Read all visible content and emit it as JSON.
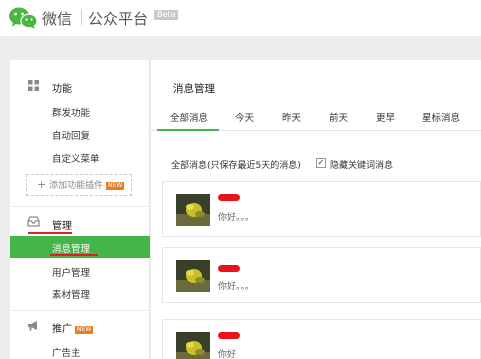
{
  "header": {
    "brand_wechat": "微信",
    "brand_platform": "公众平台",
    "beta": "Beta"
  },
  "sidebar": {
    "functions_title": "功能",
    "function_items": [
      "群发功能",
      "自动回复",
      "自定义菜单"
    ],
    "add_plugin": "添加功能插件",
    "new_badge": "NEW",
    "manage_title": "管理",
    "manage_items": [
      "消息管理",
      "用户管理",
      "素材管理"
    ],
    "promote_title": "推广",
    "promote_items": [
      "广告主"
    ]
  },
  "main": {
    "title": "消息管理",
    "tabs": [
      "全部消息",
      "今天",
      "昨天",
      "前天",
      "更早",
      "星标消息"
    ],
    "active_tab": "全部消息",
    "filter_text": "全部消息(只保存最近5天的消息)",
    "hide_keyword": {
      "label": "隐藏关键词消息",
      "checked": true
    },
    "messages": [
      {
        "text": "你好。。。"
      },
      {
        "text": "你好。。。"
      },
      {
        "text": "你好"
      }
    ]
  },
  "colors": {
    "accent": "#44b549",
    "annotation_red": "#e02020",
    "badge_orange": "#e67e22"
  }
}
